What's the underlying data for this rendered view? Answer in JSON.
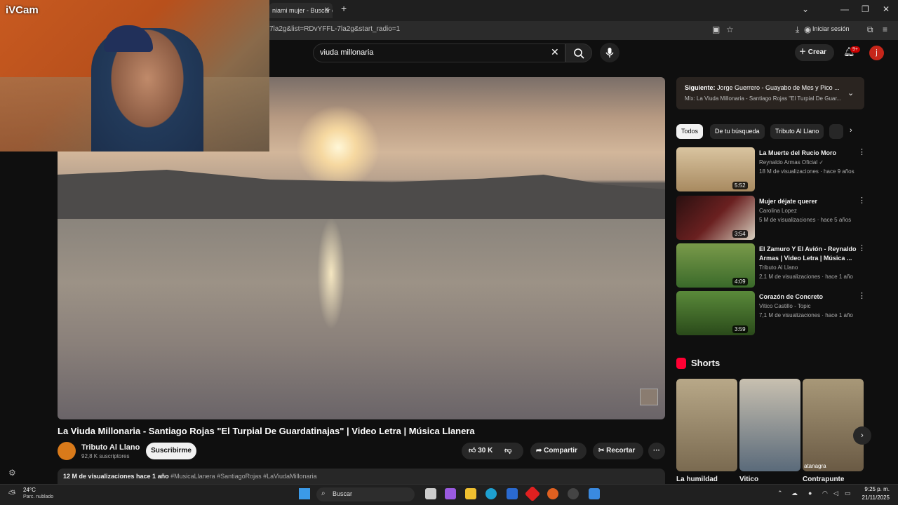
{
  "browser": {
    "tab_title": "niami mujer - Buscar c",
    "tab_close": "✕",
    "new_tab": "+",
    "url": "7la2g&list=RDvYFFL-7la2g&start_radio=1",
    "sign_in": "Iniciar sesión",
    "window_controls": [
      "⌄",
      "—",
      "❐",
      "✕"
    ]
  },
  "webcam": {
    "label": "iVCam"
  },
  "youtube": {
    "search_value": "viuda millonaria",
    "create_label": "Crear",
    "notifications_badge": "9+",
    "avatar_letter": "j"
  },
  "video": {
    "title": "La Viuda Millonaria - Santiago Rojas \"El Turpial De Guardatinajas\" | Video Letra | Música Llanera",
    "channel_name": "Tributo Al Llano",
    "subscribers": "92,8 K suscriptores",
    "subscribe_label": "Suscribirme",
    "likes": "30 K",
    "share_label": "Compartir",
    "clip_label": "Recortar",
    "more_label": "···",
    "views_and_time": "12 M de visualizaciones  hace 1 año",
    "hashtags": "#MusicaLlanera #SantiagoRojas #LaViudaMillonaria"
  },
  "up_next": {
    "line1_label": "Siguiente:",
    "line1_text": "Jorge Guerrero - Guayabo de Mes y Pico ...",
    "line2": "Mix: La Viuda Millonaria - Santiago Rojas \"El Turpial De Guar..."
  },
  "chips": [
    "Todos",
    "De tu búsqueda",
    "Tributo Al Llano"
  ],
  "recommendations": [
    {
      "title": "La Muerte del Rucio Moro",
      "channel": "Reynaldo Armas Oficial ✓",
      "meta": "18 M de visualizaciones · hace 9 años",
      "duration": "5:52",
      "color": "#c9b08a"
    },
    {
      "title": "Mujer déjate querer",
      "channel": "Carolina Lopez",
      "meta": "5 M de visualizaciones · hace 5 años",
      "duration": "3:54",
      "color": "#5a1a1a"
    },
    {
      "title": "El Zamuro Y El Avión - Reynaldo Armas | Video Letra | Música ...",
      "channel": "Tributo Al Llano",
      "meta": "2,1 M de visualizaciones · hace 1 año",
      "duration": "4:09",
      "color": "#6a8a3a"
    },
    {
      "title": "Corazón de Concreto",
      "channel": "Vitico Castillo - Topic",
      "meta": "7,1 M de visualizaciones · hace 1 año",
      "duration": "3:59",
      "color": "#3a6a2a"
    }
  ],
  "shorts": {
    "heading": "Shorts",
    "items": [
      {
        "title": "La humildad",
        "color": "#8a7a5a"
      },
      {
        "title": "Vitico",
        "color": "#7a8a6a"
      },
      {
        "title": "Contrapunte",
        "color": "#9a8a6a"
      }
    ],
    "watermark": "atanagra"
  },
  "taskbar": {
    "temperature": "24°C",
    "weather": "Parc. nublado",
    "search_label": "Buscar",
    "time": "9:25 p. m.",
    "date": "21/11/2025"
  }
}
